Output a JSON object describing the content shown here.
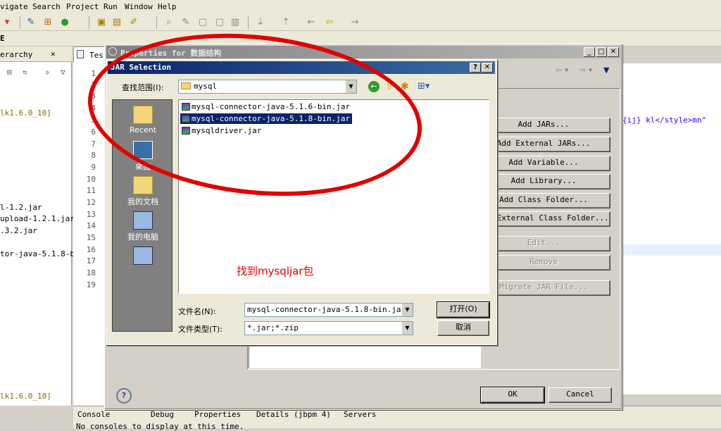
{
  "menu": [
    "vigate",
    "Search",
    "Project",
    "Run",
    "Window",
    "Help"
  ],
  "perspective_label": "E",
  "left_view": {
    "tab_title": "erarchy",
    "items": [
      "lk1.6.0_10]",
      "l-1.2.jar",
      "upload-1.2.1.jar",
      ".3.2.jar",
      "tor-java-5.1.8-bi",
      "lk1.6.0_10]"
    ]
  },
  "editor": {
    "tab_label": "Tes",
    "line_numbers": [
      "1",
      "2",
      "3",
      "4",
      "5",
      "6",
      "7",
      "8",
      "9",
      "10",
      "11",
      "12",
      "13",
      "14",
      "15",
      "16",
      "17",
      "18",
      "19"
    ],
    "right_code": "{ij} kl</style>mn\""
  },
  "bottom_tabs": [
    "Console",
    "Debug",
    "Properties",
    "Details (jbpm 4)",
    "Servers"
  ],
  "bottom_text": "No consoles to display at this time.",
  "properties_dialog": {
    "title": "Properties for 数据结构",
    "buttons": [
      "Add JARs...",
      "Add External JARs...",
      "Add Variable...",
      "Add Library...",
      "Add Class Folder...",
      "Add External Class Folder..."
    ],
    "disabled_buttons": [
      "Edit...",
      "Remove",
      "Migrate JAR File..."
    ],
    "ok": "OK",
    "cancel": "Cancel",
    "help": "?"
  },
  "jar_dialog": {
    "title": "JAR Selection",
    "look_in_label": "查找范围(I):",
    "look_in_value": "mysql",
    "places": [
      "Recent",
      "桌面",
      "我的文档",
      "我的电脑",
      ""
    ],
    "files": [
      "mysql-connector-java-5.1.6-bin.jar",
      "mysql-connector-java-5.1.8-bin.jar",
      "mysqldriver.jar"
    ],
    "selected_index": 1,
    "filename_label": "文件名(N):",
    "filename_value": "mysql-connector-java-5.1.8-bin.jar",
    "filetype_label": "文件类型(T):",
    "filetype_value": "*.jar;*.zip",
    "open_button": "打开(O)",
    "cancel_button": "取消"
  },
  "annotation": "找到mysqljar包",
  "colors": {
    "title_active": "#0a246a",
    "selection": "#0a246a",
    "annotation": "#e10000"
  }
}
